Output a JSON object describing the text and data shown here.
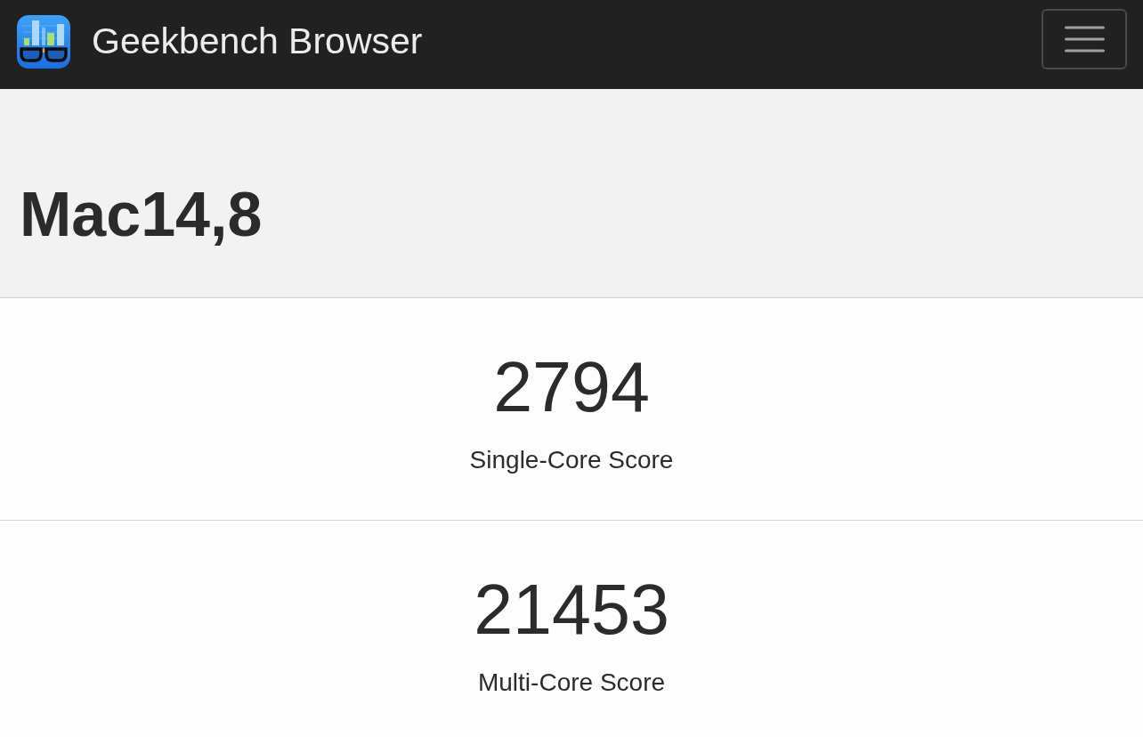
{
  "navbar": {
    "title": "Geekbench Browser"
  },
  "header": {
    "title": "Mac14,8"
  },
  "scores": [
    {
      "value": "2794",
      "label": "Single-Core Score"
    },
    {
      "value": "21453",
      "label": "Multi-Core Score"
    }
  ]
}
